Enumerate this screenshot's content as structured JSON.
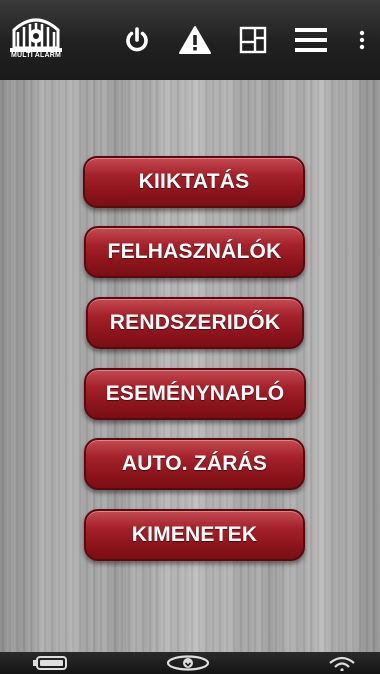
{
  "header": {
    "logo_text": "MULTI ALARM",
    "icons": [
      "power-icon",
      "warning-icon",
      "floorplan-icon",
      "hamburger-menu-icon",
      "more-vert-icon"
    ]
  },
  "menu": {
    "buttons": [
      {
        "label": "KIIKTATÁS"
      },
      {
        "label": "FELHASZNÁLÓK"
      },
      {
        "label": "RENDSZERIDŐK"
      },
      {
        "label": "ESEMÉNYNAPLÓ"
      },
      {
        "label": "AUTO. ZÁRÁS"
      },
      {
        "label": "KIMENETEK"
      }
    ]
  },
  "footer": {
    "icons": [
      "battery-icon",
      "connection-icon",
      "wifi-icon"
    ]
  },
  "colors": {
    "button_red": "#a5222b",
    "bar_dark": "#1e1e1e",
    "text_white": "#ffffff"
  }
}
